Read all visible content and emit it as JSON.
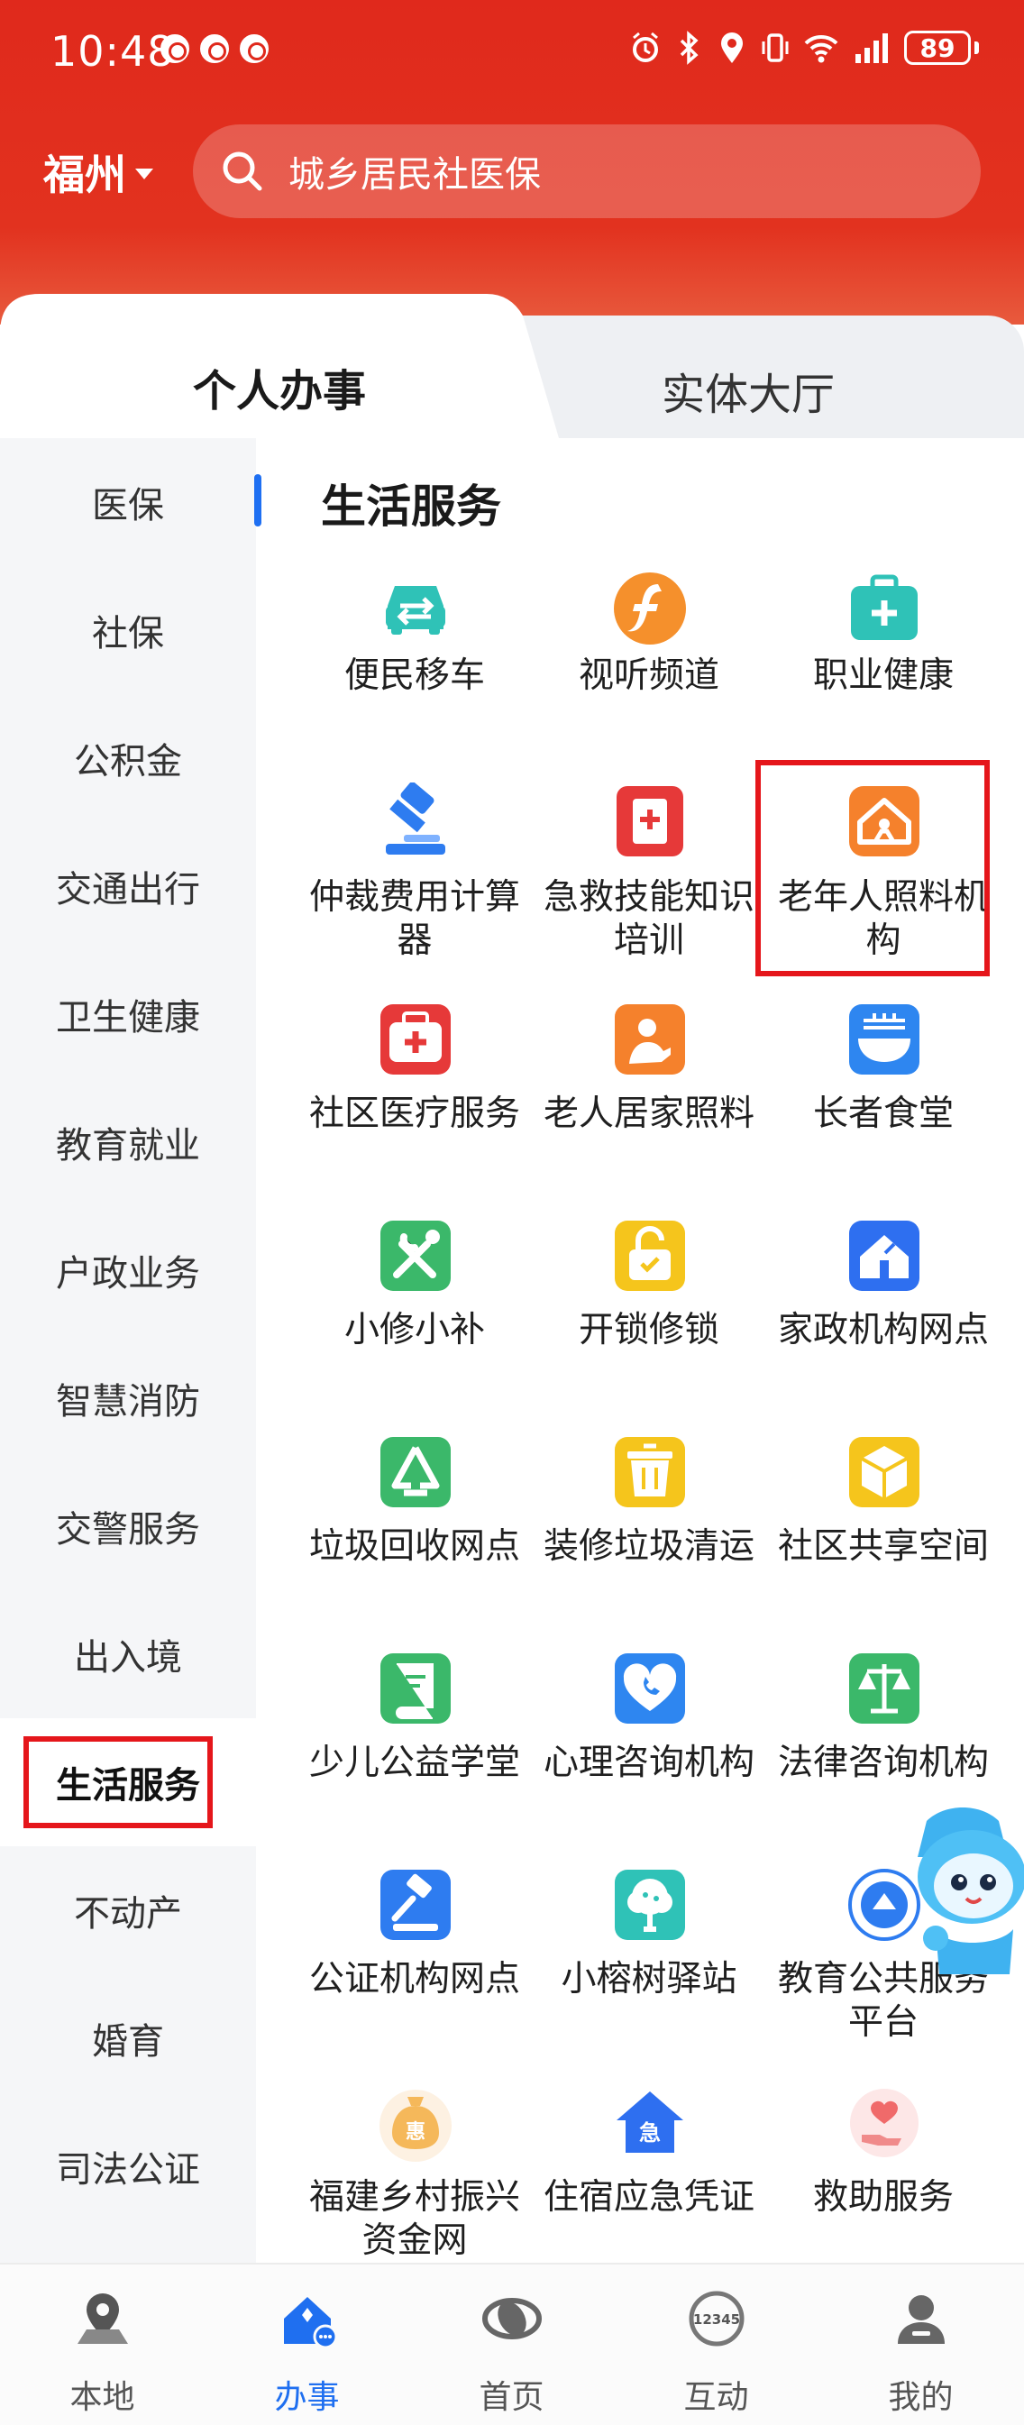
{
  "status_bar": {
    "time": "10:48",
    "battery": "89",
    "notif_icons": [
      "notification-icon",
      "notification-icon",
      "notification-icon"
    ],
    "right_icons": [
      "alarm-icon",
      "bluetooth-icon",
      "location-icon",
      "vibrate-icon",
      "wifi-icon",
      "signal-icon"
    ]
  },
  "header": {
    "city": "福州",
    "search_placeholder": "城乡居民社医保"
  },
  "tabs": [
    {
      "label": "个人办事",
      "active": true
    },
    {
      "label": "实体大厅",
      "active": false
    }
  ],
  "sidebar": {
    "items": [
      {
        "label": "医保"
      },
      {
        "label": "社保"
      },
      {
        "label": "公积金"
      },
      {
        "label": "交通出行"
      },
      {
        "label": "卫生健康"
      },
      {
        "label": "教育就业"
      },
      {
        "label": "户政业务"
      },
      {
        "label": "智慧消防"
      },
      {
        "label": "交警服务"
      },
      {
        "label": "出入境"
      },
      {
        "label": "生活服务",
        "active": true
      },
      {
        "label": "不动产"
      },
      {
        "label": "婚育"
      },
      {
        "label": "司法公证"
      }
    ]
  },
  "main": {
    "section_title": "生活服务",
    "services": [
      {
        "label": "便民移车",
        "icon": "car-icon",
        "color": "#2fc2b7"
      },
      {
        "label": "视听频道",
        "icon": "video-channel-icon",
        "color": "#f5902c"
      },
      {
        "label": "职业健康",
        "icon": "medical-kit-icon",
        "color": "#2fc2b7"
      },
      {
        "label": "仲裁费用计算器",
        "icon": "gavel-icon",
        "color": "#2e7cf0"
      },
      {
        "label": "急救技能知识培训",
        "icon": "first-aid-book-icon",
        "color": "#e63939"
      },
      {
        "label": "老年人照料机构",
        "icon": "elderly-home-icon",
        "color": "#f5812c"
      },
      {
        "label": "社区医疗服务",
        "icon": "medical-bag-icon",
        "color": "#e63939"
      },
      {
        "label": "老人居家照料",
        "icon": "home-care-icon",
        "color": "#f5812c"
      },
      {
        "label": "长者食堂",
        "icon": "canteen-icon",
        "color": "#2e86f0"
      },
      {
        "label": "小修小补",
        "icon": "repair-tools-icon",
        "color": "#3bb86a"
      },
      {
        "label": "开锁修锁",
        "icon": "lock-icon",
        "color": "#f5c51c"
      },
      {
        "label": "家政机构网点",
        "icon": "housekeeping-icon",
        "color": "#2e6ff0"
      },
      {
        "label": "垃圾回收网点",
        "icon": "recycle-icon",
        "color": "#3bb86a"
      },
      {
        "label": "装修垃圾清运",
        "icon": "trash-bin-icon",
        "color": "#f5c51c"
      },
      {
        "label": "社区共享空间",
        "icon": "box-icon",
        "color": "#f5c51c"
      },
      {
        "label": "少儿公益学堂",
        "icon": "book-icon",
        "color": "#3bb86a"
      },
      {
        "label": "心理咨询机构",
        "icon": "heart-phone-icon",
        "color": "#2e86f0"
      },
      {
        "label": "法律咨询机构",
        "icon": "scales-icon",
        "color": "#3bb86a"
      },
      {
        "label": "公证机构网点",
        "icon": "notary-gavel-icon",
        "color": "#2e7cf0"
      },
      {
        "label": "小榕树驿站",
        "icon": "tree-icon",
        "color": "#2fc2b7"
      },
      {
        "label": "教育公共服务平台",
        "icon": "education-logo-icon",
        "color": "#2e7cf0"
      },
      {
        "label": "福建乡村振兴资金网",
        "icon": "money-bag-icon",
        "color": "#f5b85a"
      },
      {
        "label": "住宿应急凭证",
        "icon": "emergency-house-icon",
        "color": "#2e6ff0"
      },
      {
        "label": "救助服务",
        "icon": "helping-hand-icon",
        "color": "#f08a8a"
      }
    ]
  },
  "bottom_nav": [
    {
      "label": "本地",
      "icon": "location-pin-icon"
    },
    {
      "label": "办事",
      "icon": "service-icon",
      "active": true
    },
    {
      "label": "首页",
      "icon": "home-logo-icon"
    },
    {
      "label": "互动",
      "icon": "hotline-12345-icon",
      "badge": "12345"
    },
    {
      "label": "我的",
      "icon": "profile-icon"
    }
  ],
  "mascot": {
    "icon": "mascot-icon"
  },
  "colors": {
    "header_red": "#e0291c",
    "accent_blue": "#1f6ff0",
    "highlight_red": "#e5161b"
  }
}
